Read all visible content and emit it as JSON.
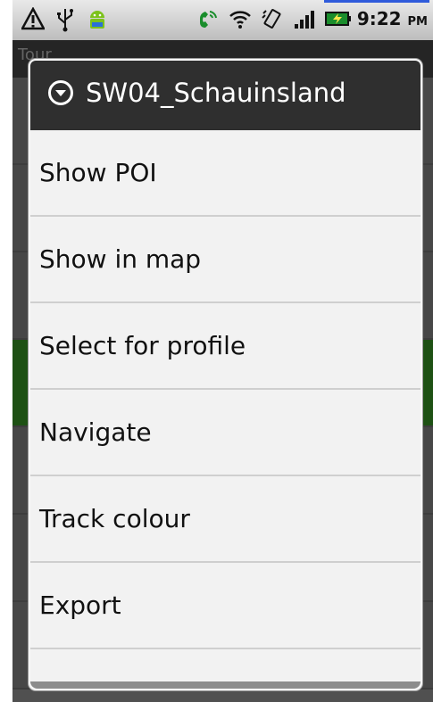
{
  "status_bar": {
    "time": "9:22",
    "ampm": "PM",
    "left_icons": [
      "warning-icon",
      "usb-icon",
      "android-icon"
    ],
    "right_icons": [
      "phone-call-icon",
      "wifi-icon",
      "vibrate-icon",
      "signal-icon",
      "battery-charging-icon"
    ]
  },
  "app": {
    "title": "Tour"
  },
  "dialog": {
    "title": "SW04_Schauinsland",
    "items": [
      {
        "label": "Show POI"
      },
      {
        "label": "Show in map"
      },
      {
        "label": "Select for profile"
      },
      {
        "label": "Navigate"
      },
      {
        "label": "Track colour"
      },
      {
        "label": "Export"
      }
    ]
  },
  "colors": {
    "dialog_header": "#2f2f2f",
    "dialog_body": "#f2f2f2",
    "highlight_row": "#2e7d1f"
  }
}
